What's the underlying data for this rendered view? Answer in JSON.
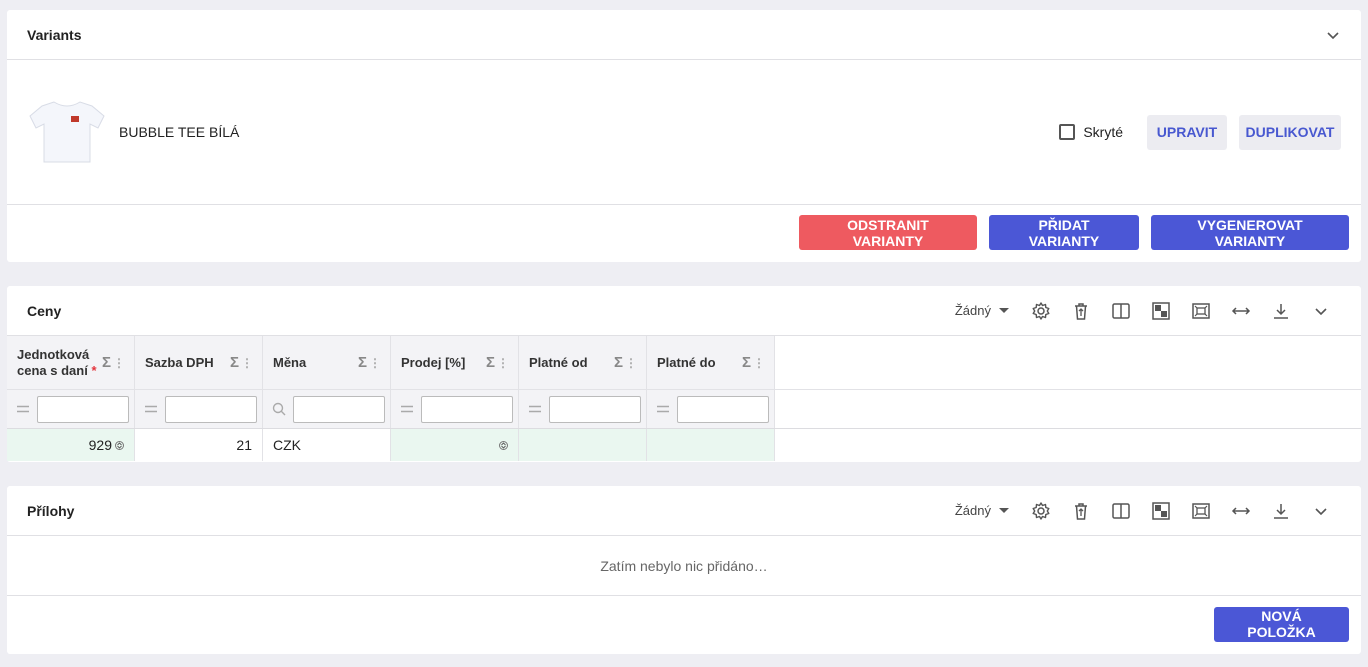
{
  "variants": {
    "title": "Variants",
    "item": {
      "name": "BUBBLE TEE BÍLÁ",
      "hidden_label": "Skryté",
      "hidden_checked": false
    },
    "edit_label": "UPRAVIT",
    "duplicate_label": "DUPLIKOVAT",
    "remove_label": "ODSTRANIT VARIANTY",
    "add_label": "PŘIDAT VARIANTY",
    "generate_label": "VYGENEROVAT VARIANTY"
  },
  "prices": {
    "title": "Ceny",
    "grouping": "Žádný",
    "columns": [
      {
        "label_1": "Jednotková",
        "label_2": "cena s daní",
        "required_mark": "*"
      },
      {
        "label": "Sazba DPH"
      },
      {
        "label": "Měna"
      },
      {
        "label": "Prodej [%]"
      },
      {
        "label": "Platné od"
      },
      {
        "label": "Platné do"
      }
    ],
    "sum_icon": "Σ",
    "rows": [
      {
        "unit_price": "929",
        "vat": "21",
        "currency": "CZK",
        "sale": "",
        "valid_from": "",
        "valid_to": ""
      }
    ]
  },
  "attachments": {
    "title": "Přílohy",
    "grouping": "Žádný",
    "empty_text": "Zatím nebylo nic přidáno…",
    "new_item_label": "NOVÁ POLOŽKA"
  },
  "colors": {
    "accent": "#4b57d6",
    "danger": "#ee5a60",
    "edited_cell": "#eaf7f0",
    "background": "#eeeef3"
  },
  "icons": [
    "chevron-down-icon",
    "gear-icon",
    "trash-icon",
    "columns-icon",
    "checker-icon",
    "fit-icon",
    "expand-width-icon",
    "download-icon",
    "filter-equals-icon",
    "search-icon",
    "sum-icon",
    "stepper-icon",
    "tshirt-icon"
  ]
}
